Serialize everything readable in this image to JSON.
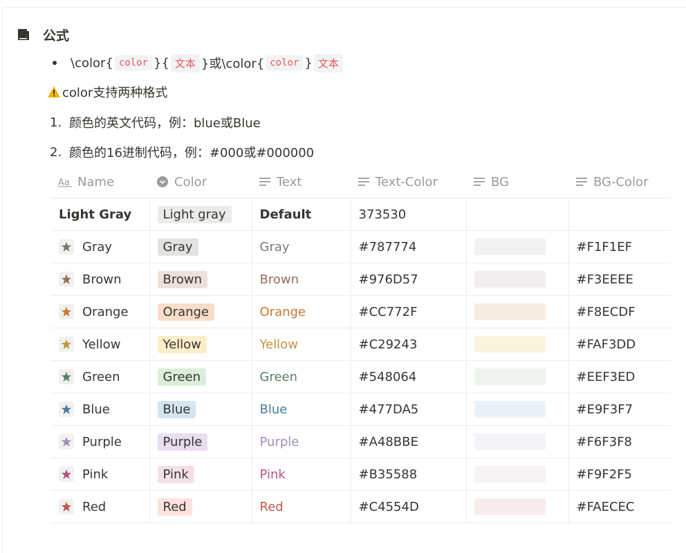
{
  "heading": {
    "title": "公式",
    "icon": "book-icon"
  },
  "formula": {
    "prefix1": "\\color{",
    "arg1": "color",
    "mid1": "}{",
    "arg2": "文本",
    "mid2": "}或\\color{",
    "arg3": "color",
    "mid3": "}",
    "arg4": "文本"
  },
  "note": {
    "icon": "warning-icon",
    "text": "color支持两种格式"
  },
  "list": [
    {
      "num": "1.",
      "text": "颜色的英文代码，例：blue或Blue"
    },
    {
      "num": "2.",
      "text": "颜色的16进制代码，例：#000或#000000"
    }
  ],
  "table": {
    "headers": [
      {
        "label": "Name",
        "icon": "text-type-icon"
      },
      {
        "label": "Color",
        "icon": "select-icon"
      },
      {
        "label": "Text",
        "icon": "lines-icon"
      },
      {
        "label": "Text-Color",
        "icon": "lines-icon"
      },
      {
        "label": "BG",
        "icon": "lines-icon"
      },
      {
        "label": "BG-Color",
        "icon": "lines-icon"
      }
    ],
    "rows": [
      {
        "name": "Light Gray",
        "color": "Light gray",
        "text": "Default",
        "text_color": "373530",
        "bg_color": "",
        "tag_bg": "#ebebea",
        "text_hex": "#373530",
        "swatch": "",
        "star": ""
      },
      {
        "name": "Gray",
        "color": "Gray",
        "text": "Gray",
        "text_color": "#787774",
        "bg_color": "#F1F1EF",
        "tag_bg": "#e3e2e0",
        "text_hex": "#787774",
        "swatch": "#F1F1EF",
        "star": "#787774"
      },
      {
        "name": "Brown",
        "color": "Brown",
        "text": "Brown",
        "text_color": "#976D57",
        "bg_color": "#F3EEEE",
        "tag_bg": "#eee0da",
        "text_hex": "#976D57",
        "swatch": "#F3EEEE",
        "star": "#976D57"
      },
      {
        "name": "Orange",
        "color": "Orange",
        "text": "Orange",
        "text_color": "#CC772F",
        "bg_color": "#F8ECDF",
        "tag_bg": "#fadec9",
        "text_hex": "#CC772F",
        "swatch": "#F8ECDF",
        "star": "#CC772F"
      },
      {
        "name": "Yellow",
        "color": "Yellow",
        "text": "Yellow",
        "text_color": "#C29243",
        "bg_color": "#FAF3DD",
        "tag_bg": "#fbeeca",
        "text_hex": "#C29243",
        "swatch": "#FAF3DD",
        "star": "#C29243"
      },
      {
        "name": "Green",
        "color": "Green",
        "text": "Green",
        "text_color": "#548064",
        "bg_color": "#EEF3ED",
        "tag_bg": "#dbeddb",
        "text_hex": "#548064",
        "swatch": "#EEF3ED",
        "star": "#548064"
      },
      {
        "name": "Blue",
        "color": "Blue",
        "text": "Blue",
        "text_color": "#477DA5",
        "bg_color": "#E9F3F7",
        "tag_bg": "#d3e5ef",
        "text_hex": "#477DA5",
        "swatch": "#E9F3F7",
        "star": "#477DA5"
      },
      {
        "name": "Purple",
        "color": "Purple",
        "text": "Purple",
        "text_color": "#A48BBE",
        "bg_color": "#F6F3F8",
        "tag_bg": "#e8deee",
        "text_hex": "#A48BBE",
        "swatch": "#F6F3F8",
        "star": "#A48BBE"
      },
      {
        "name": "Pink",
        "color": "Pink",
        "text": "Pink",
        "text_color": "#B35588",
        "bg_color": "#F9F2F5",
        "tag_bg": "#f5e0e9",
        "text_hex": "#B35588",
        "swatch": "#F9F2F5",
        "star": "#B35588"
      },
      {
        "name": "Red",
        "color": "Red",
        "text": "Red",
        "text_color": "#C4554D",
        "bg_color": "#FAECEC",
        "tag_bg": "#ffe2dd",
        "text_hex": "#C4554D",
        "swatch": "#FAECEC",
        "star": "#C4554D"
      }
    ]
  }
}
